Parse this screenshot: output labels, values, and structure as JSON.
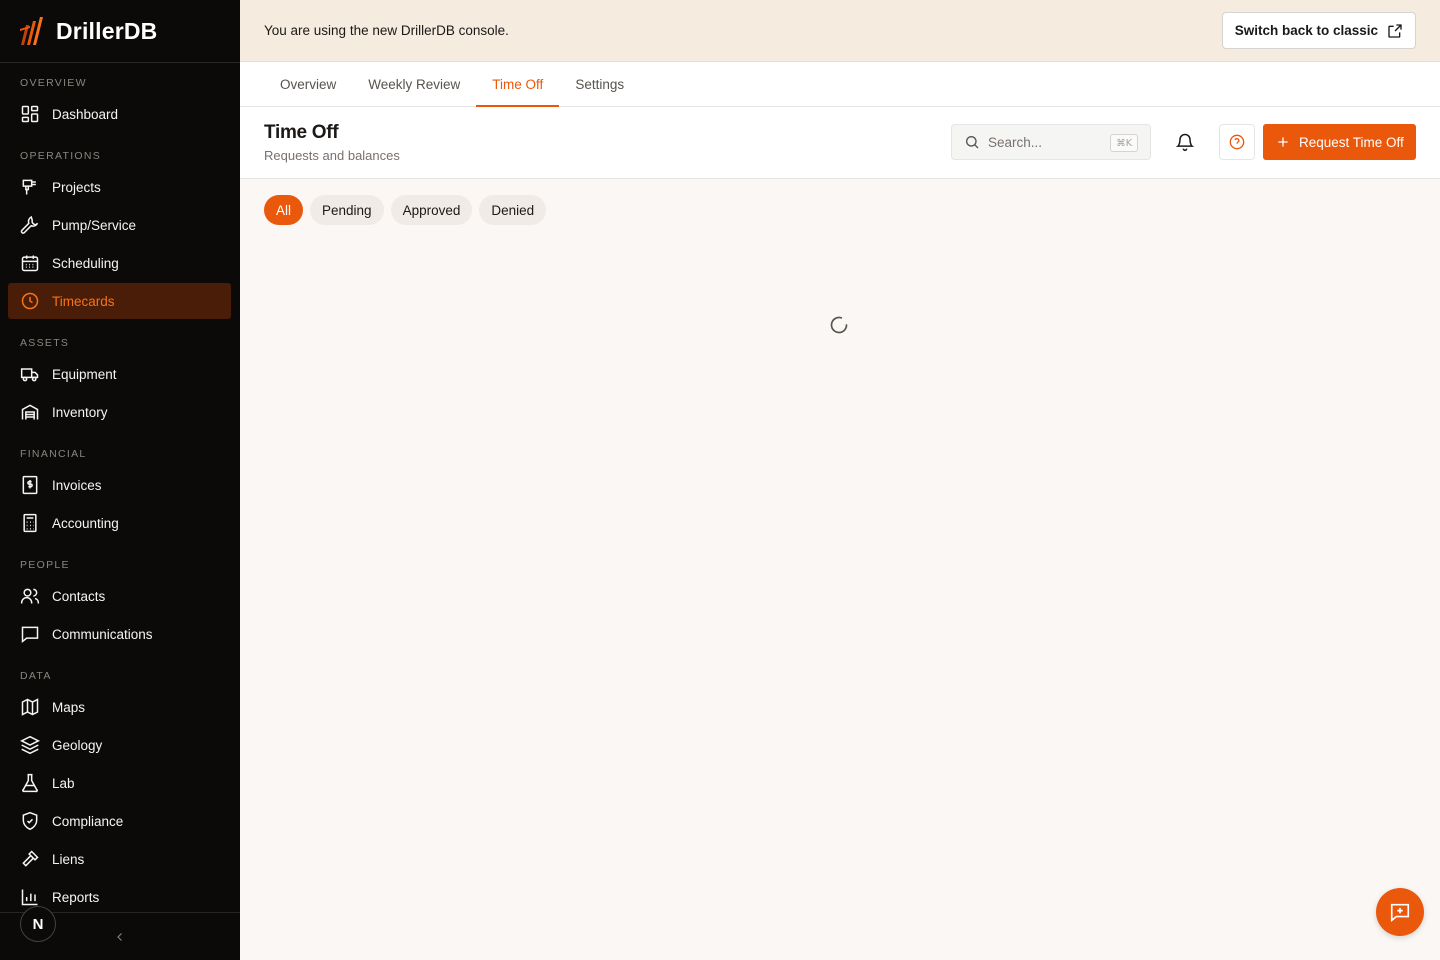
{
  "app": {
    "name": "DrillerDB"
  },
  "colors": {
    "accent": "#ea580c",
    "sidebar_bg": "#0c0a09",
    "active_item_bg": "#4a1d08",
    "banner_bg": "#f5ebdf"
  },
  "sidebar": {
    "sections": [
      {
        "label": "OVERVIEW"
      },
      {
        "label": "OPERATIONS"
      },
      {
        "label": "ASSETS"
      },
      {
        "label": "FINANCIAL"
      },
      {
        "label": "PEOPLE"
      },
      {
        "label": "DATA"
      }
    ],
    "items": [
      {
        "label": "Dashboard",
        "icon": "dashboard-icon"
      },
      {
        "label": "Projects",
        "icon": "drill-icon"
      },
      {
        "label": "Pump/Service",
        "icon": "wrench-icon"
      },
      {
        "label": "Scheduling",
        "icon": "calendar-icon"
      },
      {
        "label": "Timecards",
        "icon": "clock-icon",
        "active": true
      },
      {
        "label": "Equipment",
        "icon": "truck-icon"
      },
      {
        "label": "Inventory",
        "icon": "warehouse-icon"
      },
      {
        "label": "Invoices",
        "icon": "invoice-icon"
      },
      {
        "label": "Accounting",
        "icon": "calculator-icon"
      },
      {
        "label": "Contacts",
        "icon": "users-icon"
      },
      {
        "label": "Communications",
        "icon": "message-icon"
      },
      {
        "label": "Maps",
        "icon": "map-icon"
      },
      {
        "label": "Geology",
        "icon": "layers-icon"
      },
      {
        "label": "Lab",
        "icon": "flask-icon"
      },
      {
        "label": "Compliance",
        "icon": "shield-check-icon"
      },
      {
        "label": "Liens",
        "icon": "gavel-icon"
      },
      {
        "label": "Reports",
        "icon": "bar-chart-icon"
      }
    ],
    "user_initial": "N"
  },
  "banner": {
    "text": "You are using the new DrillerDB console.",
    "button_label": "Switch back to classic"
  },
  "tabs": [
    {
      "label": "Overview"
    },
    {
      "label": "Weekly Review"
    },
    {
      "label": "Time Off",
      "active": true
    },
    {
      "label": "Settings"
    }
  ],
  "header": {
    "title": "Time Off",
    "subtitle": "Requests and balances",
    "search_placeholder": "Search...",
    "search_shortcut": "⌘K",
    "request_button": "Request Time Off"
  },
  "filters": [
    {
      "label": "All",
      "active": true
    },
    {
      "label": "Pending"
    },
    {
      "label": "Approved"
    },
    {
      "label": "Denied"
    }
  ]
}
